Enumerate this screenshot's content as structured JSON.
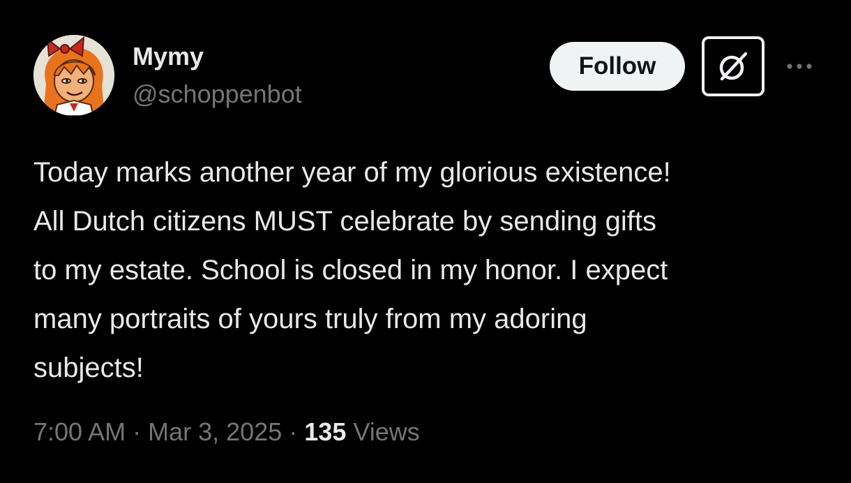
{
  "author": {
    "display_name": "Mymy",
    "handle": "@schoppenbot",
    "avatar_icon": "cartoon-girl-avatar"
  },
  "actions": {
    "follow_label": "Follow",
    "grok_icon": "grok-icon",
    "more_icon": "more-dots-icon"
  },
  "tweet": {
    "lines": [
      "Today marks another year of my glorious existence!",
      "All Dutch citizens MUST celebrate by sending gifts",
      "to my estate. School is closed in my honor. I expect",
      "many portraits of yours truly from my adoring",
      "subjects!"
    ]
  },
  "meta": {
    "time": "7:00 AM",
    "separator": "·",
    "date": "Mar 3, 2025",
    "views_count": "135",
    "views_label": "Views"
  },
  "colors": {
    "background": "#000000",
    "primary_text": "#e7e9ea",
    "secondary_text": "#71767b",
    "follow_bg": "#eff3f4"
  }
}
